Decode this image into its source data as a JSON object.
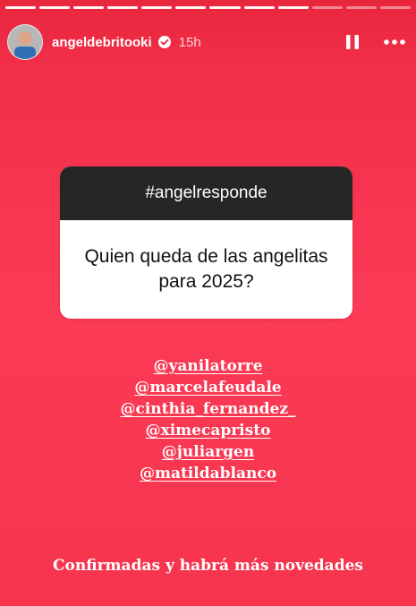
{
  "story": {
    "progress_segments": 12,
    "progress_active": 9,
    "user": {
      "username": "angeldebritooki",
      "time": "15h",
      "verified": true
    },
    "controls": {
      "pause_icon": "pause-icon",
      "more_icon": "more-icon"
    },
    "question": {
      "header": "#angelresponde",
      "text": "Quien queda de las angelitas para 2025?"
    },
    "mentions": [
      "@yanilatorre",
      "@marcelafeudale",
      "@cinthia_fernandez_",
      "@ximecapristo",
      "@juliargen",
      "@matildablanco"
    ],
    "caption": "Confirmadas y habrá más novedades",
    "colors": {
      "background": "#fb3a55",
      "question_header": "#262626",
      "text": "#ffffff"
    }
  }
}
